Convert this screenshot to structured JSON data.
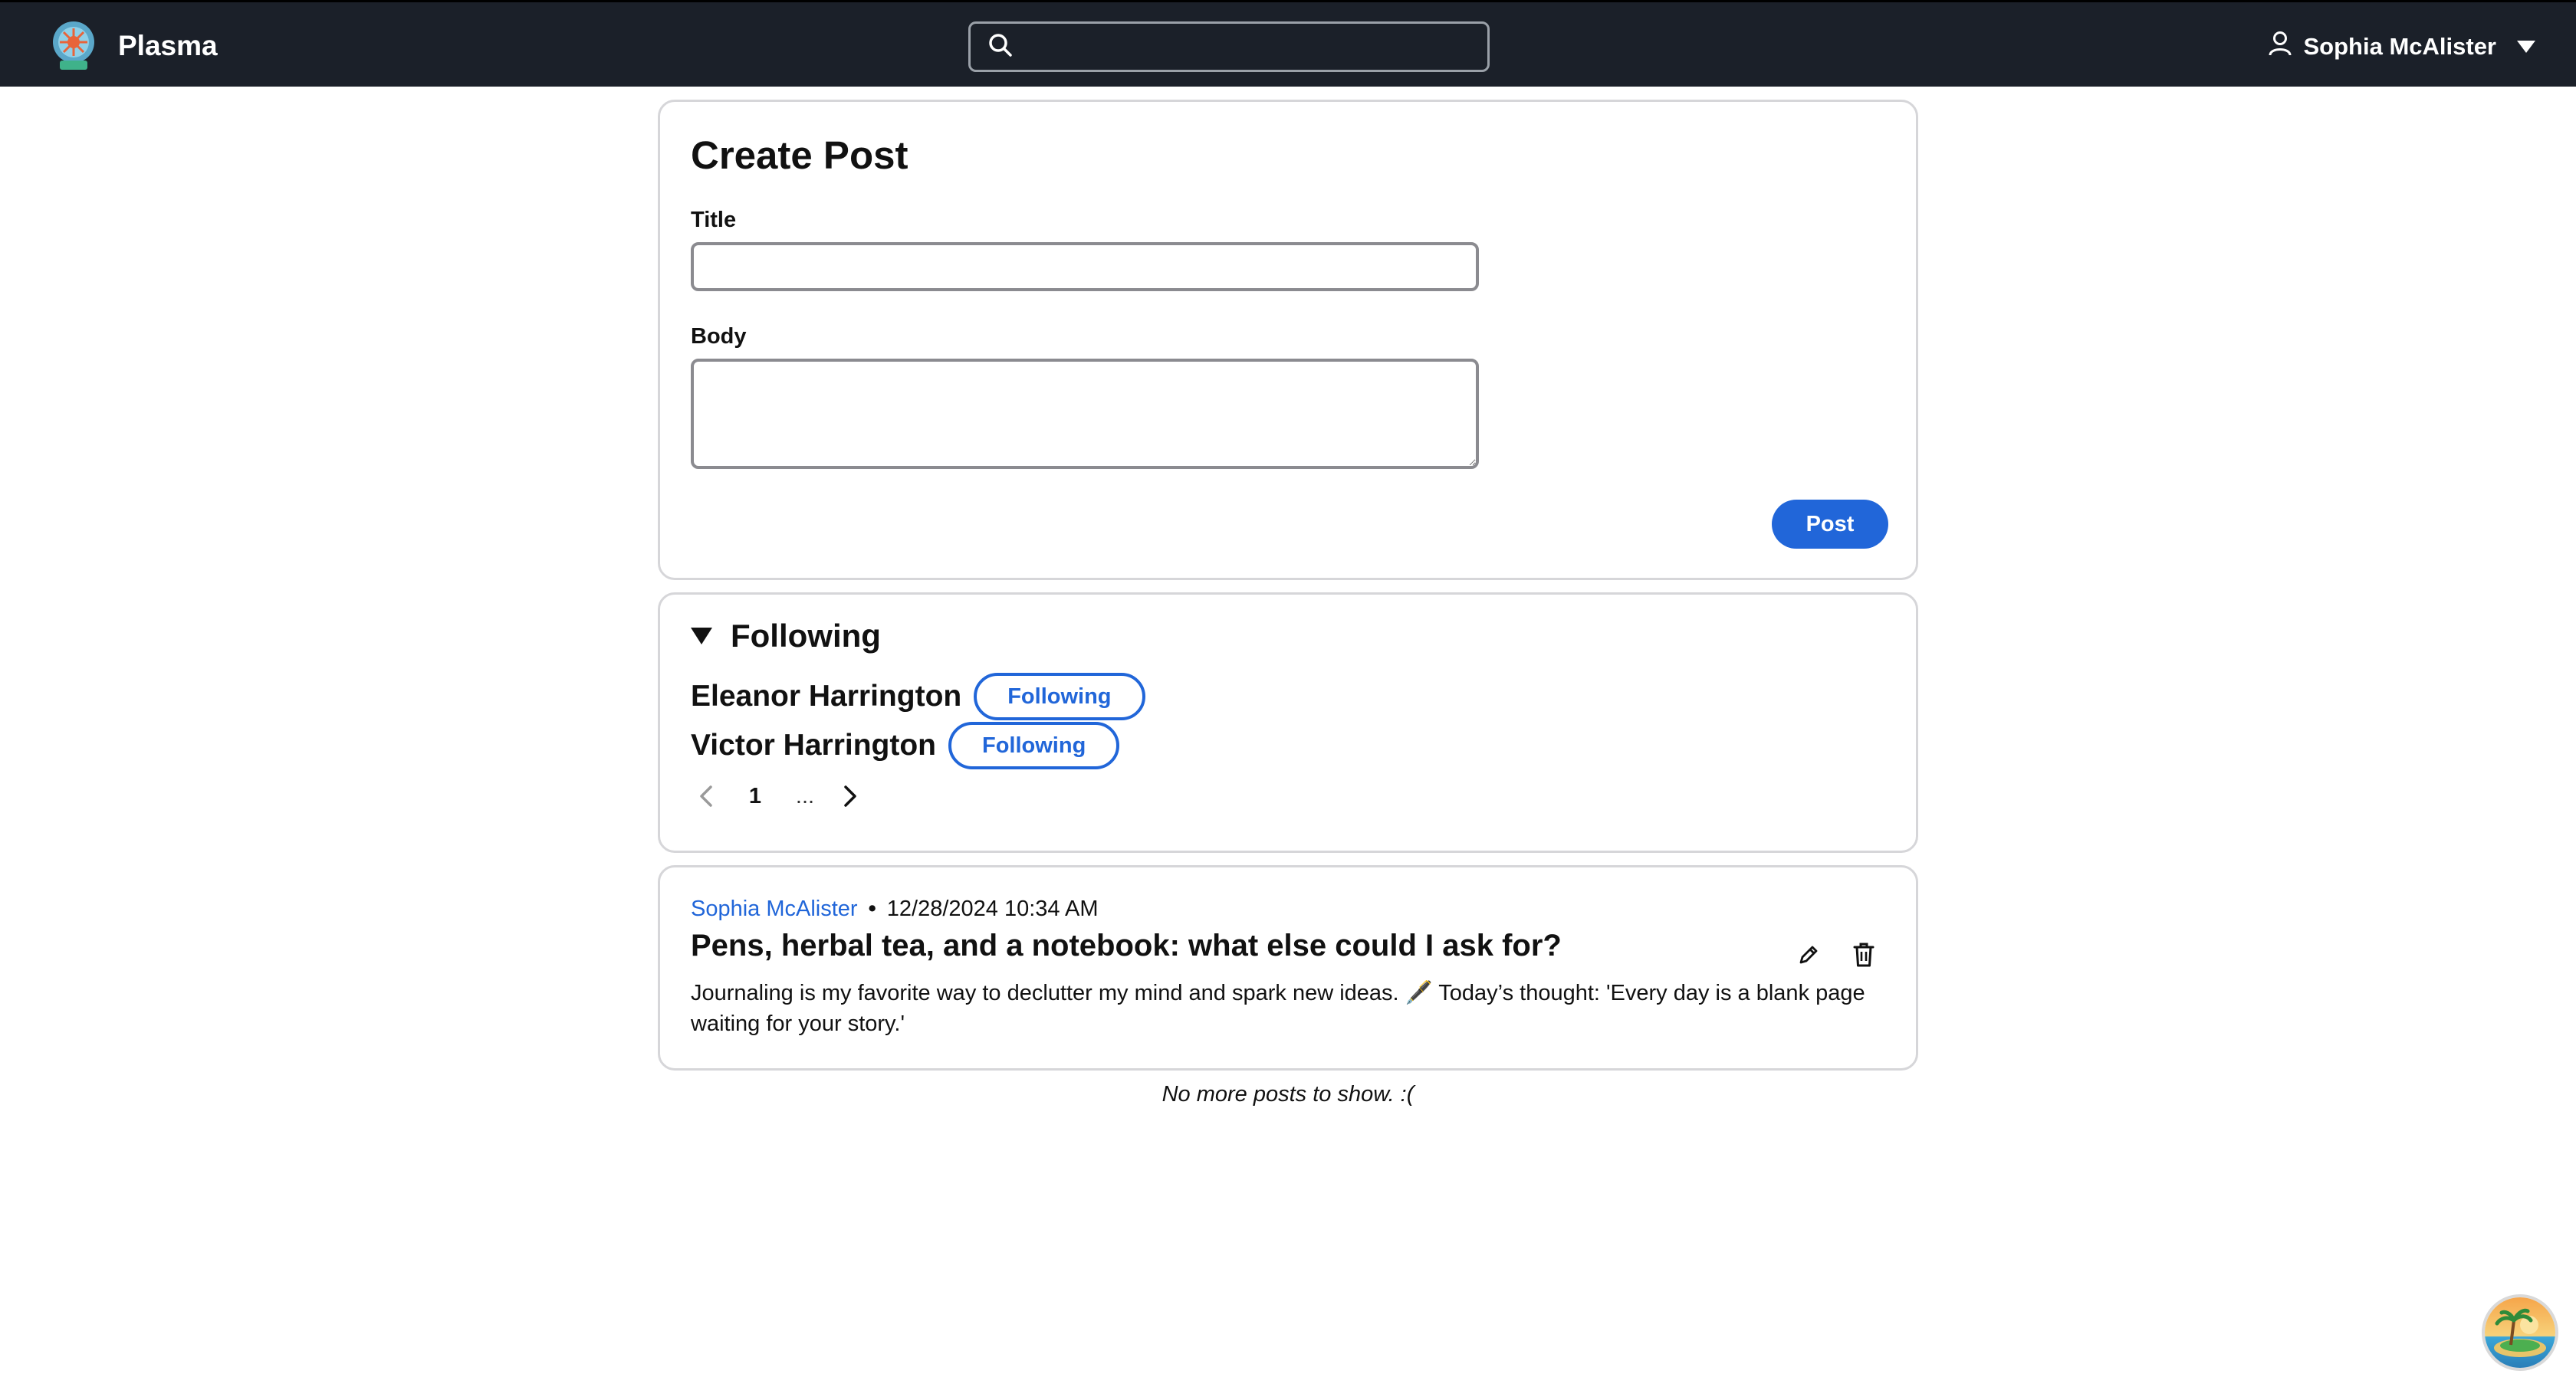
{
  "app": {
    "name": "Plasma",
    "logo_icon": "globe-logo-icon"
  },
  "search": {
    "icon": "search-icon",
    "value": "",
    "placeholder": ""
  },
  "user": {
    "name": "Sophia McAlister",
    "icon": "user-icon",
    "menu_icon": "caret-down-icon"
  },
  "create_post": {
    "heading": "Create Post",
    "title_label": "Title",
    "title_value": "",
    "body_label": "Body",
    "body_value": "",
    "submit_label": "Post"
  },
  "following": {
    "heading": "Following",
    "toggle_icon": "triangle-down-icon",
    "people": [
      {
        "name": "Eleanor Harrington",
        "button_label": "Following"
      },
      {
        "name": "Victor Harrington",
        "button_label": "Following"
      }
    ],
    "pagination": {
      "current": "1",
      "ellipsis": "...",
      "prev_icon": "chevron-left-icon",
      "next_icon": "chevron-right-icon"
    }
  },
  "posts": [
    {
      "author": "Sophia McAlister",
      "separator": "•",
      "timestamp": "12/28/2024 10:34 AM",
      "title": "Pens, herbal tea, and a notebook: what else could I ask for?",
      "body": "Journaling is my favorite way to declutter my mind and spark new ideas. 🖋️ Today’s thought: 'Every day is a blank page waiting for your story.'",
      "edit_icon": "pencil-icon",
      "delete_icon": "trash-icon"
    }
  ],
  "feed_end_message": "No more posts to show. :(",
  "assistant_bubble": {
    "icon": "island-avatar-icon"
  },
  "colors": {
    "header_bg": "#1b2029",
    "accent": "#2166d9",
    "card_border": "#d6d6d9"
  }
}
